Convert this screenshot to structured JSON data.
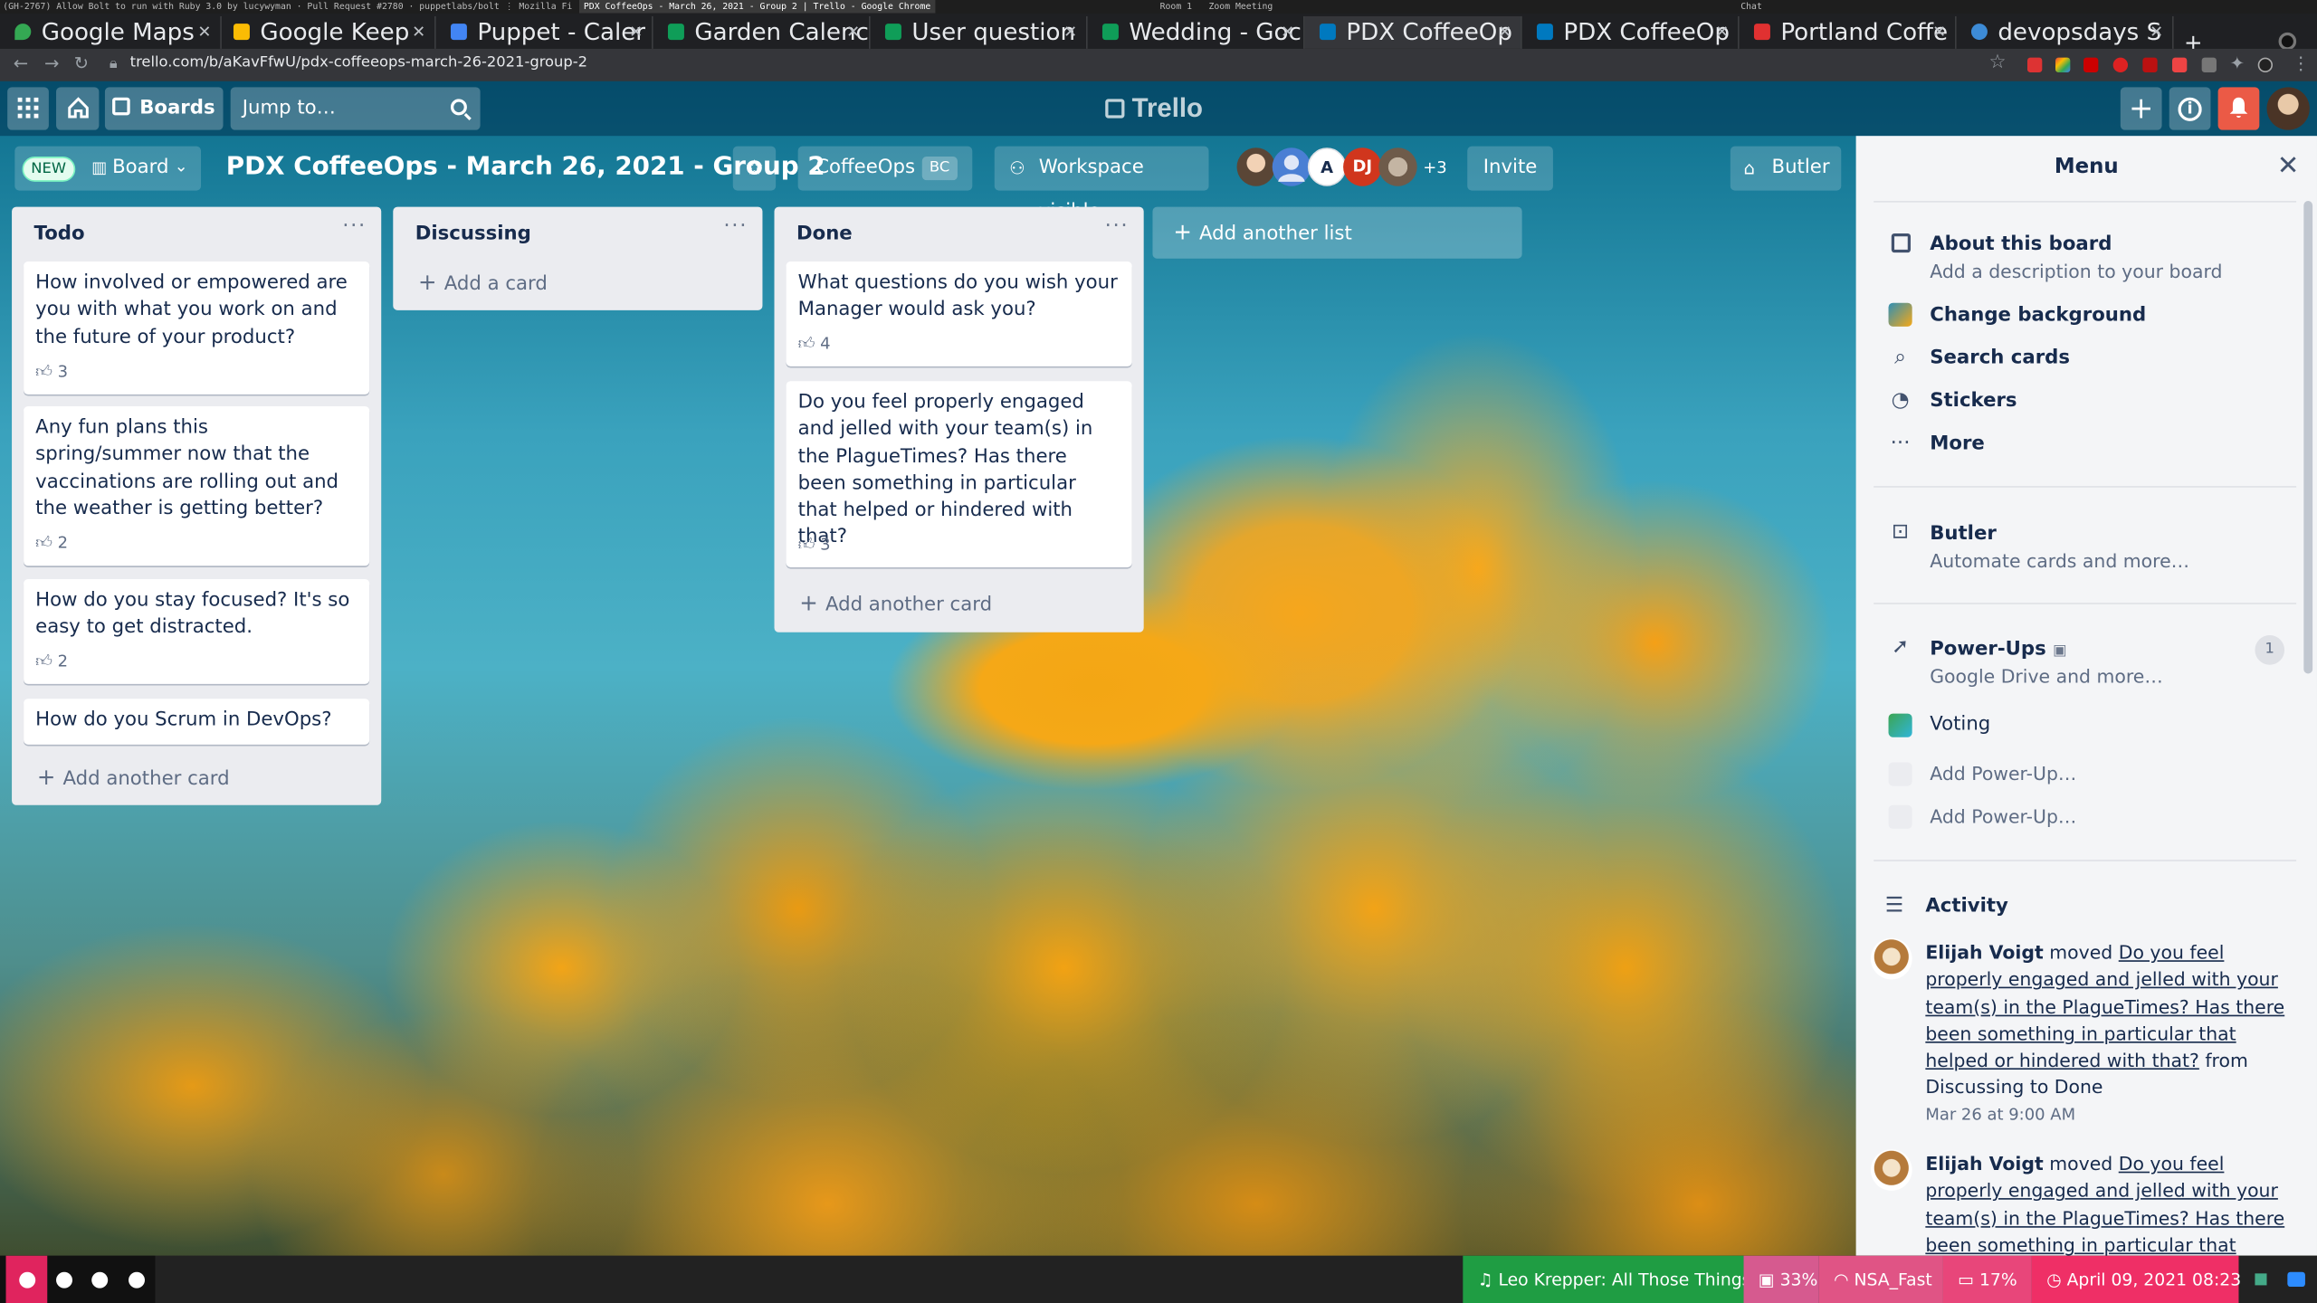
{
  "system": {
    "left_text": "(GH-2767) Allow Bolt to run with Ruby 3.0 by lucywyman · Pull Request #2780 · puppetlabs/bolt ⋮ Mozilla Fi",
    "window_title": "PDX CoffeeOps - March 26, 2021 - Group 2 | Trello - Google Chrome",
    "room": "Room 1",
    "zoom": "Zoom Meeting",
    "chat": "Chat"
  },
  "browser": {
    "tabs": [
      {
        "label": "Google Maps",
        "color": "#34a853"
      },
      {
        "label": "Google Keep",
        "color": "#fbbc04"
      },
      {
        "label": "Puppet - Caler",
        "color": "#4285f4"
      },
      {
        "label": "Garden Calenc",
        "color": "#0f9d58"
      },
      {
        "label": "User question",
        "color": "#0f9d58"
      },
      {
        "label": "Wedding - Goc",
        "color": "#0f9d58"
      },
      {
        "label": "PDX CoffeeOp",
        "color": "#0079bf"
      },
      {
        "label": "PDX CoffeeOp",
        "color": "#0079bf"
      },
      {
        "label": "Portland Coffe",
        "color": "#e03131"
      },
      {
        "label": "devopsdays S",
        "color": "#3d8bd6"
      }
    ],
    "new_tab": "+",
    "url": "trello.com/b/aKavFfwU/pdx-coffeeops-march-26-2021-group-2"
  },
  "header": {
    "boards_label": "Boards",
    "search_placeholder": "Jump to…",
    "logo": "Trello"
  },
  "board": {
    "new_badge": "NEW",
    "view_label": "Board",
    "title": "PDX CoffeeOps - March 26, 2021 - Group 2",
    "workspace": "CoffeeOps",
    "workspace_badge": "BC",
    "visibility": "Workspace visible",
    "members": [
      {
        "initials": "",
        "color": "#5a4636"
      },
      {
        "initials": "",
        "color": "#4a7fd4"
      },
      {
        "initials": "A",
        "color": "#ffffff"
      },
      {
        "initials": "DJ",
        "color": "#d0361d"
      },
      {
        "initials": "",
        "color": "#8d7b6a"
      }
    ],
    "more_members": "+3",
    "invite": "Invite",
    "butler": "Butler"
  },
  "lists": [
    {
      "title": "Todo",
      "cards": [
        {
          "text": "How involved or empowered are you with what you work on and the future of your product?",
          "votes": "3"
        },
        {
          "text": "Any fun plans this spring/summer now that the vaccinations are rolling out and the weather is getting better?",
          "votes": "2"
        },
        {
          "text": "How do you stay focused? It's so easy to get distracted.",
          "votes": "2"
        },
        {
          "text": "How do you Scrum in DevOps?",
          "votes": ""
        }
      ],
      "add_label": "Add another card"
    },
    {
      "title": "Discussing",
      "cards": [],
      "add_label": "Add a card"
    },
    {
      "title": "Done",
      "cards": [
        {
          "text": "What questions do you wish your Manager would ask you?",
          "votes": "4"
        },
        {
          "text": "Do you feel properly engaged and jelled with your team(s) in the PlagueTimes? Has there been something in particular that helped or hindered with that?",
          "votes": "3"
        }
      ],
      "add_label": "Add another card"
    }
  ],
  "add_list_label": "Add another list",
  "menu": {
    "title": "Menu",
    "about": "About this board",
    "about_sub": "Add a description to your board",
    "change_bg": "Change background",
    "search": "Search cards",
    "stickers": "Stickers",
    "more": "More",
    "butler": "Butler",
    "butler_sub": "Automate cards and more…",
    "powerups": "Power-Ups",
    "powerups_sub": "Google Drive and more…",
    "powerups_count": "1",
    "voting": "Voting",
    "add_powerup_1": "Add Power-Up…",
    "add_powerup_2": "Add Power-Up…",
    "activity": "Activity",
    "activities": [
      {
        "user": "Elijah Voigt",
        "verb": "moved",
        "card": "Do you feel properly engaged and jelled with your team(s) in the PlagueTimes? Has there been something in particular that helped or hindered with that?",
        "detail": "from Discussing to Done",
        "time": "Mar 26 at 9:00 AM"
      },
      {
        "user": "Elijah Voigt",
        "verb": "moved",
        "card": "Do you feel properly engaged and jelled with your team(s) in the PlagueTimes? Has there been something in particular that helped or",
        "detail": "",
        "time": ""
      }
    ]
  },
  "taskbar": {
    "music": "Leo Krepper: All Those Things",
    "disk": "33%",
    "wifi": "NSA_Fast",
    "battery": "17%",
    "datetime": "April 09, 2021 08:23"
  }
}
